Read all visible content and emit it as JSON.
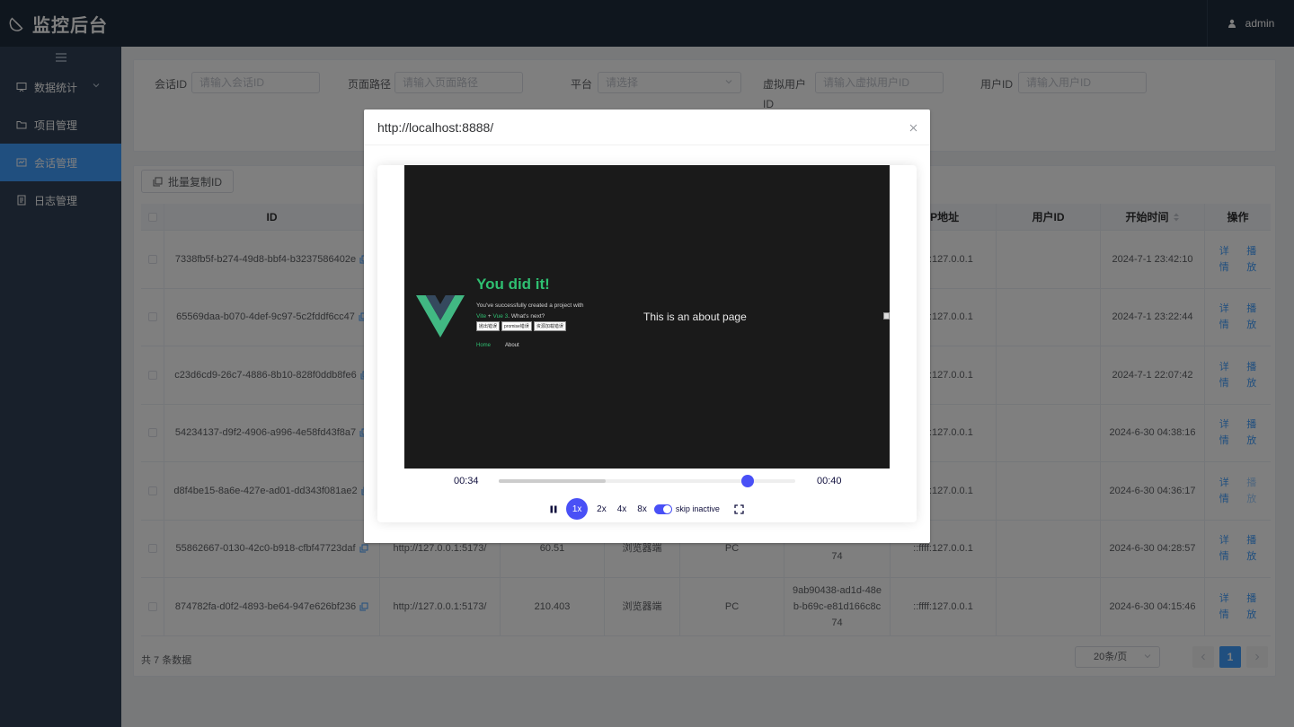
{
  "app": {
    "title": "监控后台",
    "user": "admin"
  },
  "sidebar": {
    "items": [
      {
        "label": "数据统计",
        "icon": "chart-icon",
        "active": false,
        "has_children": true
      },
      {
        "label": "项目管理",
        "icon": "folder-icon",
        "active": false
      },
      {
        "label": "会话管理",
        "icon": "session-icon",
        "active": true
      },
      {
        "label": "日志管理",
        "icon": "document-icon",
        "active": false
      }
    ]
  },
  "search": {
    "session_id_label": "会话ID",
    "session_id_placeholder": "请输入会话ID",
    "page_path_label": "页面路径",
    "page_path_placeholder": "请输入页面路径",
    "platform_label": "平台",
    "platform_placeholder": "请选择",
    "virtual_user_label_line1": "虚拟用户",
    "virtual_user_label_line2": "ID",
    "virtual_user_placeholder": "请输入虚拟用户ID",
    "user_id_label": "用户ID",
    "user_id_placeholder": "请输入用户ID"
  },
  "toolbar": {
    "copy_ids_label": "批量复制ID"
  },
  "table": {
    "headers": {
      "id": "ID",
      "ip": "IP地址",
      "user_id": "用户ID",
      "start_time": "开始时间",
      "actions": "操作"
    },
    "rows": [
      {
        "id": "7338fb5f-b274-49d8-bbf4-b3237586402e",
        "url": "",
        "duration": "",
        "client": "",
        "platform": "",
        "vuid_1": "",
        "vuid_2": "",
        "vuid_3": "",
        "ip": "::ffff:127.0.0.1",
        "user_id": "",
        "start": "2024-7-1 23:42:10",
        "detail": "详情",
        "play": "播放",
        "play_disabled": false
      },
      {
        "id": "65569daa-b070-4def-9c97-5c2fddf6cc47",
        "url": "",
        "duration": "",
        "client": "",
        "platform": "",
        "vuid_1": "",
        "vuid_2": "",
        "vuid_3": "",
        "ip": "::ffff:127.0.0.1",
        "user_id": "",
        "start": "2024-7-1 23:22:44",
        "detail": "详情",
        "play": "播放",
        "play_disabled": false
      },
      {
        "id": "c23d6cd9-26c7-4886-8b10-828f0ddb8fe6",
        "url": "",
        "duration": "",
        "client": "",
        "platform": "",
        "vuid_1": "",
        "vuid_2": "",
        "vuid_3": "",
        "ip": "::ffff:127.0.0.1",
        "user_id": "",
        "start": "2024-7-1 22:07:42",
        "detail": "详情",
        "play": "播放",
        "play_disabled": false
      },
      {
        "id": "54234137-d9f2-4906-a996-4e58fd43f8a7",
        "url": "",
        "duration": "",
        "client": "",
        "platform": "",
        "vuid_1": "",
        "vuid_2": "",
        "vuid_3": "",
        "ip": "::ffff:127.0.0.1",
        "user_id": "",
        "start": "2024-6-30 04:38:16",
        "detail": "详情",
        "play": "播放",
        "play_disabled": false
      },
      {
        "id": "d8f4be15-8a6e-427e-ad01-dd343f081ae2",
        "url": "",
        "duration": "",
        "client": "",
        "platform": "",
        "vuid_1": "",
        "vuid_2": "",
        "vuid_3": "",
        "ip": "::ffff:127.0.0.1",
        "user_id": "",
        "start": "2024-6-30 04:36:17",
        "detail": "详情",
        "play": "播放",
        "play_disabled": true
      },
      {
        "id": "55862667-0130-42c0-b918-cfbf47723daf",
        "url": "http://127.0.0.1:5173/",
        "duration": "60.51",
        "client": "浏览器端",
        "platform": "PC",
        "vuid_1": "",
        "vuid_2": "b-b69c-e81d166c8c",
        "vuid_3": "74",
        "ip": "::ffff:127.0.0.1",
        "user_id": "",
        "start": "2024-6-30 04:28:57",
        "detail": "详情",
        "play": "播放",
        "play_disabled": false
      },
      {
        "id": "874782fa-d0f2-4893-be64-947e626bf236",
        "url": "http://127.0.0.1:5173/",
        "duration": "210.403",
        "client": "浏览器端",
        "platform": "PC",
        "vuid_1": "9ab90438-ad1d-48e",
        "vuid_2": "b-b69c-e81d166c8c",
        "vuid_3": "74",
        "ip": "::ffff:127.0.0.1",
        "user_id": "",
        "start": "2024-6-30 04:15:46",
        "detail": "详情",
        "play": "播放",
        "play_disabled": false
      }
    ]
  },
  "pagination": {
    "total_text": "共 7 条数据",
    "page_size": "20条/页",
    "current_page": "1"
  },
  "dialog": {
    "title": "http://localhost:8888/",
    "replay": {
      "heading": "You did it!",
      "sub_line1": "You've successfully created a project with",
      "sub_vite": "Vite",
      "sub_plus": " + ",
      "sub_vue": "Vue 3",
      "sub_next": ". What's next?",
      "buttons": [
        "抛出错误",
        "promise错误",
        "资源加载错误"
      ],
      "nav_home": "Home",
      "nav_about": "About",
      "about_text": "This is an about page"
    },
    "player": {
      "current_time": "00:34",
      "total_time": "00:40",
      "progress": 0.84,
      "buffered": 0.36,
      "speeds": [
        "1x",
        "2x",
        "4x",
        "8x"
      ],
      "active_speed": "1x",
      "skip_inactive_label": "skip inactive",
      "skip_inactive_on": true
    }
  },
  "colors": {
    "sidebar_bg": "#304156",
    "header_bg": "#1f2d3d",
    "accent": "#409eff",
    "player_accent": "#4950f6",
    "vue_green": "#2fbf71"
  }
}
